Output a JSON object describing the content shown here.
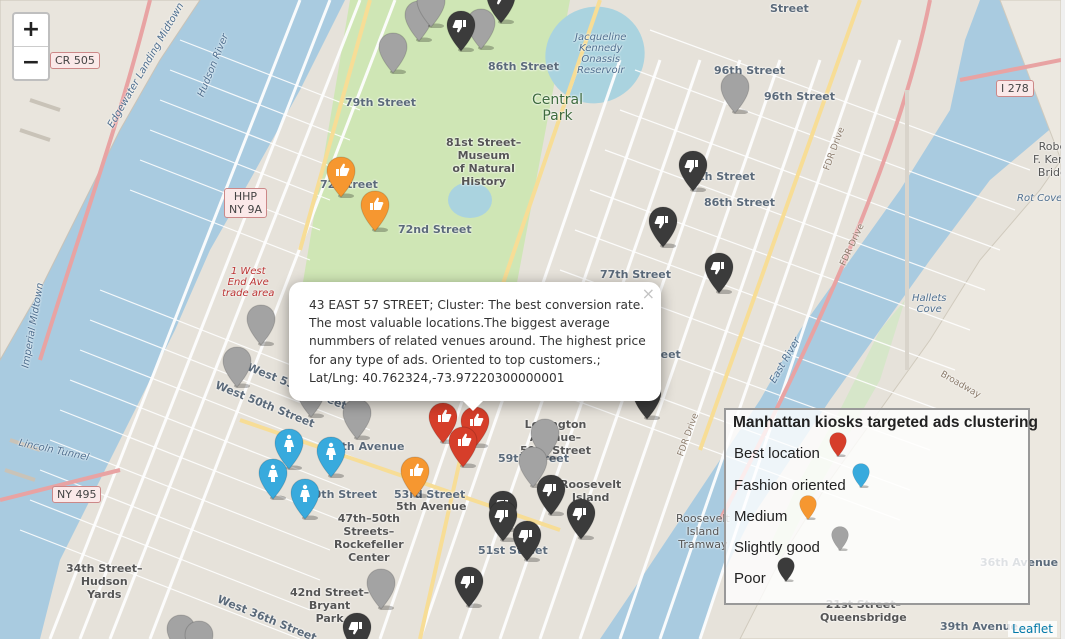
{
  "map": {
    "zoom_in": "+",
    "zoom_out": "−",
    "attribution": "Leaflet",
    "labels": {
      "central_park": "Central\nPark",
      "reservoir": "Jacqueline\nKennedy\nOnassis\nReservoir",
      "museum": "81st Street–\nMuseum\nof Natural\nHistory",
      "hudson_river": "Hudson River",
      "edgewater": "Edgewater Landing Midtown",
      "east_river": "East River",
      "rot_cove": "Rot Cove",
      "hallets_cove": "Hallets\nCove",
      "lincoln_tunnel": "Lincoln Tunnel",
      "imperial_midtown": "Imperial Midtown",
      "broadway": "Broadway",
      "queensbridge": "21st Street–\nQueensbridge",
      "roosevelt_tram": "Roosevelt\nIsland\nTramway",
      "hudson_yards": "34th Street–\nHudson\nYards",
      "bryant_park": "42nd Street–\nBryant\nPark",
      "rockefeller": "47th–50th\nStreets–\nRockefeller\nCenter",
      "fifth_ave": "5th Avenue",
      "lex": "Lexington\nAvenue–\n59th Street",
      "roosevelt_island": "Roosevelt\nIsland",
      "robert_kennedy": "Robe\nF. Kenn\nBridg",
      "west_end": "1 West\nEnd Ave\ntrade area"
    },
    "streets": {
      "s86w": "86th Street",
      "s96": "96th Street",
      "s96b": "96th Street",
      "s79": "79th Street",
      "s86e": "86th Street",
      "s86e2": "86th Street",
      "s72": "72nd Street",
      "s72b": "72 Street",
      "s77": "77th Street",
      "s53": "53rd Street",
      "s51": "51st Street",
      "s59": "59th Street",
      "s50": "50th Street",
      "s36": "36th Avenue",
      "s39": "39th Avenue",
      "w53": "West 53rd Street",
      "w50": "West 50th Street",
      "w36": "West 36th Street",
      "street_top": "Street",
      "street_top2": "Street",
      "eighth": "8th Avenue",
      "ny495": "NY 495",
      "cr505": "CR 505",
      "hhp": "HHP\nNY 9A",
      "i278": "I 278",
      "fdr1": "FDR Drive",
      "fdr2": "FDR Drive",
      "fdr3": "FDR Drive"
    }
  },
  "popup": {
    "text": "43 EAST 57 STREET; Cluster: The best conversion rate. The most valuable locations.The biggest average nummbers of related venues around. The highest price for any type of ads. Oriented to top customers.; Lat/Lng: 40.762324,-73.97220300000001",
    "close": "×"
  },
  "legend": {
    "title": "Manhattan kiosks targeted ads clustering",
    "items": [
      {
        "label": "Best location",
        "color": "#d63e2a"
      },
      {
        "label": "Fashion oriented",
        "color": "#38aadd"
      },
      {
        "label": "Medium",
        "color": "#f69730"
      },
      {
        "label": "Slightly good",
        "color": "#a3a3a3"
      },
      {
        "label": "Poor",
        "color": "#3b3b3b"
      }
    ]
  },
  "marker_colors": {
    "best": "#d63e2a",
    "fashion": "#38aadd",
    "medium": "#f69730",
    "slight": "#a3a3a3",
    "poor": "#3b3b3b"
  },
  "markers": [
    {
      "c": "slight",
      "icon": "none"
    },
    {
      "c": "slight",
      "icon": "none"
    },
    {
      "c": "slight",
      "icon": "none"
    },
    {
      "c": "slight",
      "icon": "none"
    },
    {
      "c": "poor",
      "icon": "thumbs-down"
    },
    {
      "c": "poor",
      "icon": "thumbs-down"
    },
    {
      "c": "slight",
      "icon": "none"
    },
    {
      "c": "poor",
      "icon": "thumbs-down"
    },
    {
      "c": "poor",
      "icon": "thumbs-down"
    },
    {
      "c": "poor",
      "icon": "thumbs-down"
    },
    {
      "c": "medium",
      "icon": "thumbs-up"
    },
    {
      "c": "medium",
      "icon": "thumbs-up"
    },
    {
      "c": "slight",
      "icon": "none"
    },
    {
      "c": "slight",
      "icon": "none"
    },
    {
      "c": "slight",
      "icon": "none"
    },
    {
      "c": "slight",
      "icon": "none"
    },
    {
      "c": "poor",
      "icon": "none"
    },
    {
      "c": "fashion",
      "icon": "fashion"
    },
    {
      "c": "fashion",
      "icon": "fashion"
    },
    {
      "c": "fashion",
      "icon": "fashion"
    },
    {
      "c": "fashion",
      "icon": "fashion"
    },
    {
      "c": "best",
      "icon": "thumbs-up"
    },
    {
      "c": "best",
      "icon": "thumbs-up"
    },
    {
      "c": "best",
      "icon": "thumbs-up"
    },
    {
      "c": "slight",
      "icon": "none"
    },
    {
      "c": "slight",
      "icon": "none"
    },
    {
      "c": "medium",
      "icon": "thumbs-up"
    },
    {
      "c": "poor",
      "icon": "thumbs-down"
    },
    {
      "c": "poor",
      "icon": "thumbs-down"
    },
    {
      "c": "poor",
      "icon": "thumbs-down"
    },
    {
      "c": "poor",
      "icon": "thumbs-down"
    },
    {
      "c": "poor",
      "icon": "thumbs-down"
    },
    {
      "c": "slight",
      "icon": "none"
    },
    {
      "c": "poor",
      "icon": "thumbs-down"
    },
    {
      "c": "slight",
      "icon": "none"
    },
    {
      "c": "poor",
      "icon": "thumbs-down"
    },
    {
      "c": "slight",
      "icon": "none"
    }
  ]
}
